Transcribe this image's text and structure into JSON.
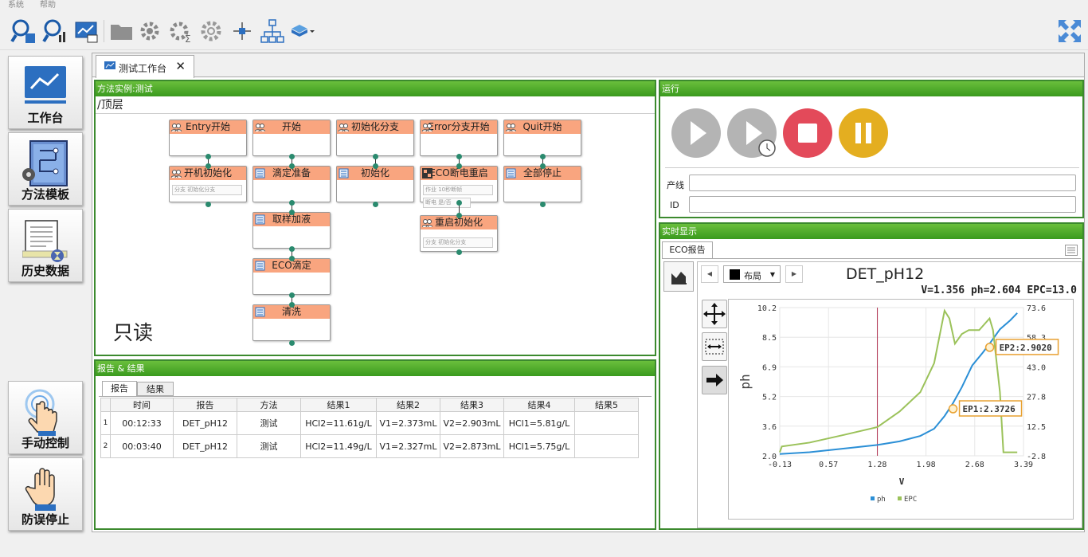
{
  "menu": [
    "系统",
    "帮助"
  ],
  "nav": [
    "工作台",
    "方法模板",
    "历史数据",
    "手动控制",
    "防误停止"
  ],
  "workspace_tab": "测试工作台",
  "method_panel": {
    "title": "方法实例:测试",
    "path": "/顶层",
    "readonly": "只读"
  },
  "nodes": [
    "Entry开始",
    "开始",
    "初始化分支",
    "Error分支开始",
    "Quit开始",
    "开机初始化",
    "滴定准备",
    "初始化",
    "ECO断电重启",
    "全部停止",
    "取样加液",
    "重启初始化",
    "ECO滴定",
    "清洗"
  ],
  "node_subs": {
    "s1": "分支",
    "s1v": "初始化分支",
    "s2": "作业",
    "s2v": "10秒断帧",
    "s3": "断电",
    "s3v": "是/否",
    "s4": "分支",
    "s4v": "初始化分支"
  },
  "run_panel": {
    "title": "运行",
    "line_label": "产线",
    "id_label": "ID"
  },
  "report_panel": {
    "title": "报告 & 结果",
    "tabs": [
      "报告",
      "结果"
    ],
    "headers": [
      "时间",
      "报告",
      "方法",
      "结果1",
      "结果2",
      "结果3",
      "结果4",
      "结果5"
    ],
    "rows": [
      {
        "n": "1",
        "time": "00:12:33",
        "report": "DET_pH12",
        "method": "测试",
        "r1": "HCl2=11.61g/L",
        "r2": "V1=2.373mL",
        "r3": "V2=2.903mL",
        "r4": "HCl1=5.81g/L",
        "r5": ""
      },
      {
        "n": "2",
        "time": "00:03:40",
        "report": "DET_pH12",
        "method": "测试",
        "r1": "HCl2=11.49g/L",
        "r2": "V1=2.327mL",
        "r3": "V2=2.873mL",
        "r4": "HCl1=5.75g/L",
        "r5": ""
      }
    ]
  },
  "rt_panel": {
    "title": "实时显示",
    "tab": "ECO报告",
    "layout": "布局"
  },
  "chart_data": {
    "type": "line",
    "title": "DET_pH12",
    "readout": "V=1.356 ph=2.604 EPC=13.0",
    "xlabel": "V",
    "ylabel": "ph",
    "xticks": [
      "-0.13",
      "0.57",
      "1.28",
      "1.98",
      "2.68",
      "3.39"
    ],
    "yticks": [
      "2.0",
      "3.6",
      "5.2",
      "6.9",
      "8.5",
      "10.2"
    ],
    "y2ticks": [
      "-2.8",
      "12.5",
      "27.8",
      "43.0",
      "58.3",
      "73.6"
    ],
    "xlim": [
      -0.13,
      3.39
    ],
    "ylim": [
      2.0,
      10.2
    ],
    "y2lim": [
      -2.8,
      73.6
    ],
    "cursor_x": 1.28,
    "series": [
      {
        "name": "ph",
        "color": "#2b8fd6",
        "x": [
          -0.13,
          0.3,
          0.8,
          1.28,
          1.6,
          1.9,
          2.1,
          2.25,
          2.37,
          2.5,
          2.65,
          2.8,
          2.9,
          3.05,
          3.2,
          3.3
        ],
        "y": [
          2.1,
          2.2,
          2.4,
          2.6,
          2.8,
          3.1,
          3.5,
          4.2,
          4.9,
          5.8,
          7.0,
          7.7,
          8.2,
          9.0,
          9.5,
          9.9
        ]
      },
      {
        "name": "EPC",
        "color": "#9bc25a",
        "x": [
          -0.13,
          -0.1,
          0.3,
          0.8,
          1.28,
          1.6,
          1.9,
          2.1,
          2.25,
          2.32,
          2.4,
          2.5,
          2.6,
          2.75,
          2.9,
          2.95,
          3.05,
          3.1,
          3.2,
          3.3
        ],
        "y": [
          -1,
          2,
          4,
          8,
          12,
          20,
          30,
          45,
          72,
          68,
          55,
          60,
          62,
          62,
          68,
          62,
          30,
          -1,
          -1,
          -1
        ]
      }
    ],
    "annotations": [
      "EP1:2.3726",
      "EP2:2.9020"
    ],
    "legend": [
      "ph",
      "EPC"
    ]
  }
}
